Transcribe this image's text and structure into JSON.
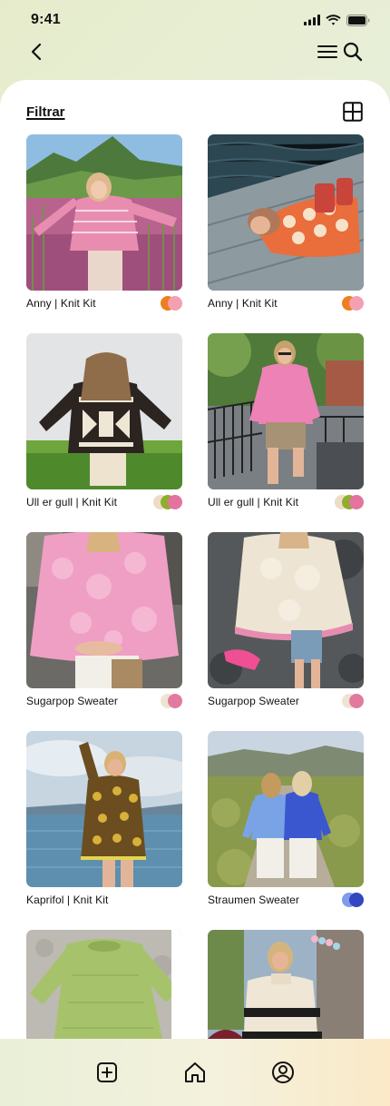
{
  "status_bar": {
    "time": "9:41"
  },
  "nav": {
    "back_icon": "chevron-left-icon",
    "menu_icon": "hamburger-menu-icon",
    "search_icon": "search-icon"
  },
  "header": {
    "filter_label": "Filtrar",
    "layout_toggle_icon": "grid-view-icon"
  },
  "products": [
    {
      "title": "Anny | Knit Kit",
      "swatches": [
        "#ee7f1f",
        "#f2a0b2"
      ]
    },
    {
      "title": "Anny | Knit Kit",
      "swatches": [
        "#ee7f1f",
        "#f2a0b2"
      ]
    },
    {
      "title": "Ull er gull | Knit Kit",
      "swatches": [
        "#eedcc8",
        "#8fae2e",
        "#e5739f"
      ]
    },
    {
      "title": "Ull er gull | Knit Kit",
      "swatches": [
        "#eedcc8",
        "#8fae2e",
        "#e5739f"
      ]
    },
    {
      "title": "Sugarpop Sweater",
      "swatches": [
        "#efe3d3",
        "#e27aa0"
      ]
    },
    {
      "title": "Sugarpop Sweater",
      "swatches": [
        "#efe3d3",
        "#e27aa0"
      ]
    },
    {
      "title": "Kaprifol | Knit Kit",
      "swatches": []
    },
    {
      "title": "Straumen Sweater",
      "swatches": [
        "#7f9bea",
        "#3546c2"
      ]
    },
    {
      "title": "",
      "swatches": []
    },
    {
      "title": "",
      "swatches": []
    }
  ],
  "tab_bar": {
    "items": [
      {
        "icon": "add-square-icon"
      },
      {
        "icon": "home-icon"
      },
      {
        "icon": "profile-icon"
      }
    ]
  }
}
